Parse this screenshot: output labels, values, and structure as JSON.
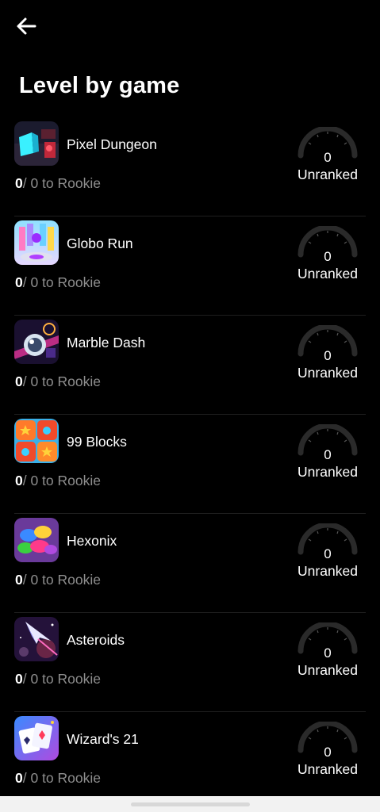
{
  "header": {
    "title": "Level by game"
  },
  "games": [
    {
      "name": "Pixel Dungeon",
      "current": "0",
      "progress_rest": "/ 0 to Rookie",
      "score": "0",
      "rank": "Unranked",
      "icon": "pixel-dungeon-icon"
    },
    {
      "name": "Globo Run",
      "current": "0",
      "progress_rest": "/ 0 to Rookie",
      "score": "0",
      "rank": "Unranked",
      "icon": "globo-run-icon"
    },
    {
      "name": "Marble Dash",
      "current": "0",
      "progress_rest": "/ 0 to Rookie",
      "score": "0",
      "rank": "Unranked",
      "icon": "marble-dash-icon"
    },
    {
      "name": "99 Blocks",
      "current": "0",
      "progress_rest": "/ 0 to Rookie",
      "score": "0",
      "rank": "Unranked",
      "icon": "99-blocks-icon"
    },
    {
      "name": "Hexonix",
      "current": "0",
      "progress_rest": "/ 0 to Rookie",
      "score": "0",
      "rank": "Unranked",
      "icon": "hexonix-icon"
    },
    {
      "name": "Asteroids",
      "current": "0",
      "progress_rest": "/ 0 to Rookie",
      "score": "0",
      "rank": "Unranked",
      "icon": "asteroids-icon"
    },
    {
      "name": "Wizard's 21",
      "current": "0",
      "progress_rest": "/ 0 to Rookie",
      "score": "0",
      "rank": "Unranked",
      "icon": "wizards-21-icon"
    }
  ],
  "colors": {
    "background": "#000000",
    "muted_text": "#8e8e8e",
    "gauge_track": "#2a2a2a"
  }
}
